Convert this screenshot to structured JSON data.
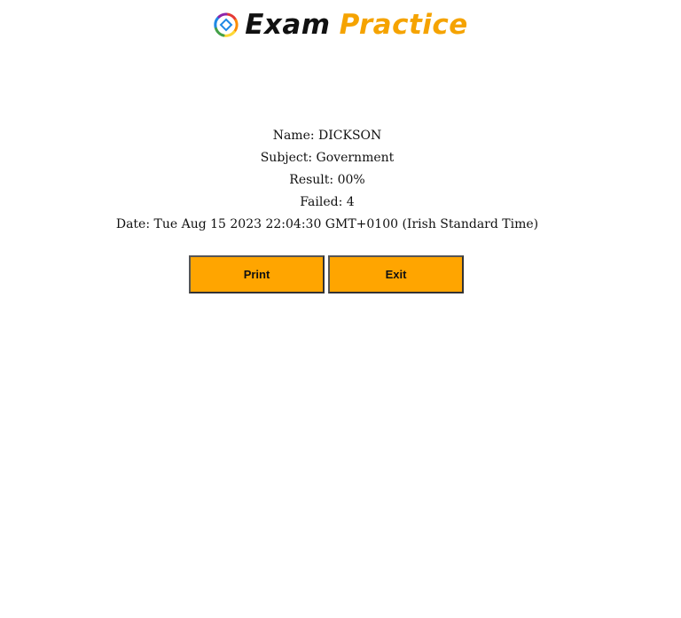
{
  "header": {
    "logo_word_1": "Exam",
    "logo_word_2": "Practice",
    "brand_colors": {
      "dark": "#111111",
      "orange": "#f5a300"
    }
  },
  "result": {
    "name": "Name: DICKSON",
    "subject": "Subject: Government",
    "result": "Result: 00%",
    "failed": "Failed: 4",
    "date": "Date: Tue Aug 15 2023 22:04:30 GMT+0100 (Irish Standard Time)"
  },
  "actions": {
    "print_label": "Print",
    "exit_label": "Exit",
    "button_color": "#ffa500"
  }
}
